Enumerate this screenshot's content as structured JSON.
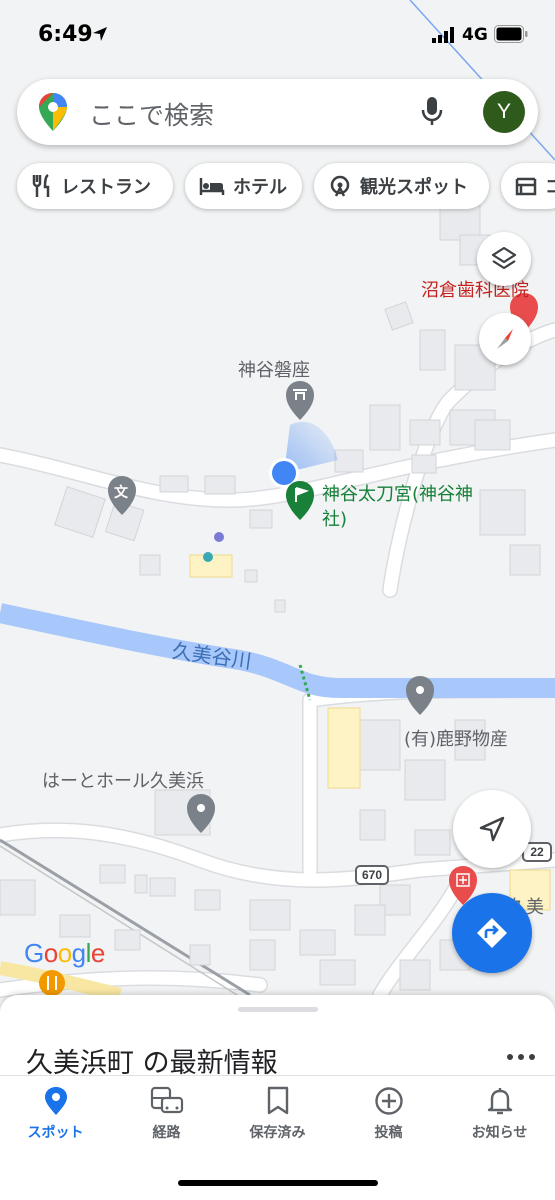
{
  "status_bar": {
    "time": "6:49",
    "network": "4G"
  },
  "search": {
    "placeholder": "ここで検索",
    "avatar_letter": "Y"
  },
  "chips": [
    {
      "label": "レストラン",
      "icon": "restaurant-icon"
    },
    {
      "label": "ホテル",
      "icon": "hotel-icon"
    },
    {
      "label": "観光スポット",
      "icon": "attraction-icon"
    },
    {
      "label": "コ",
      "icon": "shopping-icon"
    }
  ],
  "map": {
    "labels": {
      "clinic": "沼倉歯科医院",
      "iwakura": "神谷磐座",
      "shrine_line1": "神谷太刀宮(神谷神",
      "shrine_line2": "社)",
      "river": "久美谷川",
      "store": "(有)鹿野物産",
      "hall": "はーとホール久美浜",
      "kumihama_partial": "久美",
      "school_icon_glyph": "文"
    },
    "routes": {
      "route_670": "670",
      "route_partial": "22"
    },
    "google_logo": "Google",
    "colors": {
      "map_bg": "#f1f3f4",
      "road": "#ffffff",
      "river": "#a8c7fa",
      "location_blue": "#4285f4",
      "fab_blue": "#1a73e8"
    }
  },
  "sheet": {
    "title": "久美浜町 の最新情報"
  },
  "bottom_nav": {
    "items": [
      {
        "label": "スポット",
        "icon": "pin-icon",
        "active": true
      },
      {
        "label": "経路",
        "icon": "commute-icon",
        "active": false
      },
      {
        "label": "保存済み",
        "icon": "bookmark-icon",
        "active": false
      },
      {
        "label": "投稿",
        "icon": "add-circle-icon",
        "active": false
      },
      {
        "label": "お知らせ",
        "icon": "bell-icon",
        "active": false
      }
    ]
  }
}
